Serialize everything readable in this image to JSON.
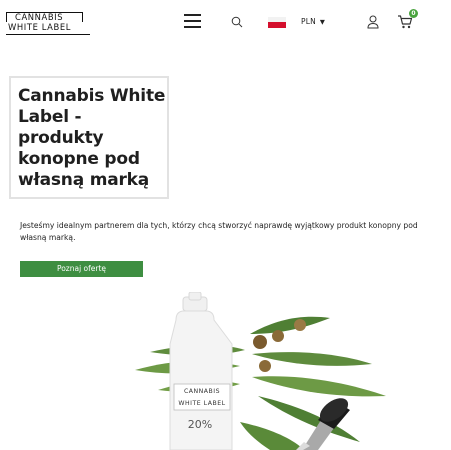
{
  "header": {
    "logo": {
      "line1": "CANNABIS",
      "line2": "WHITE LABEL"
    },
    "currency": "PLN",
    "currency_caret": "▼",
    "cart_count": "0",
    "icons": [
      "menu-icon",
      "search-icon",
      "poland-flag-icon",
      "user-icon",
      "cart-icon"
    ]
  },
  "hero": {
    "title": "Cannabis White Label - produkty konopne pod własną marką",
    "description": "Jesteśmy idealnym partnerem dla tych, którzy chcą stworzyć naprawdę wyjątkowy produkt konopny pod własną marką.",
    "cta_label": "Poznaj ofertę"
  },
  "product_image": {
    "label_line1": "CANNABIS",
    "label_line2": "WHITE LABEL",
    "percentage": "20%"
  },
  "colors": {
    "accent": "#3e8e41",
    "badge": "#4aa43f",
    "flag_red": "#d40f2d",
    "text": "#1f1f1f"
  }
}
